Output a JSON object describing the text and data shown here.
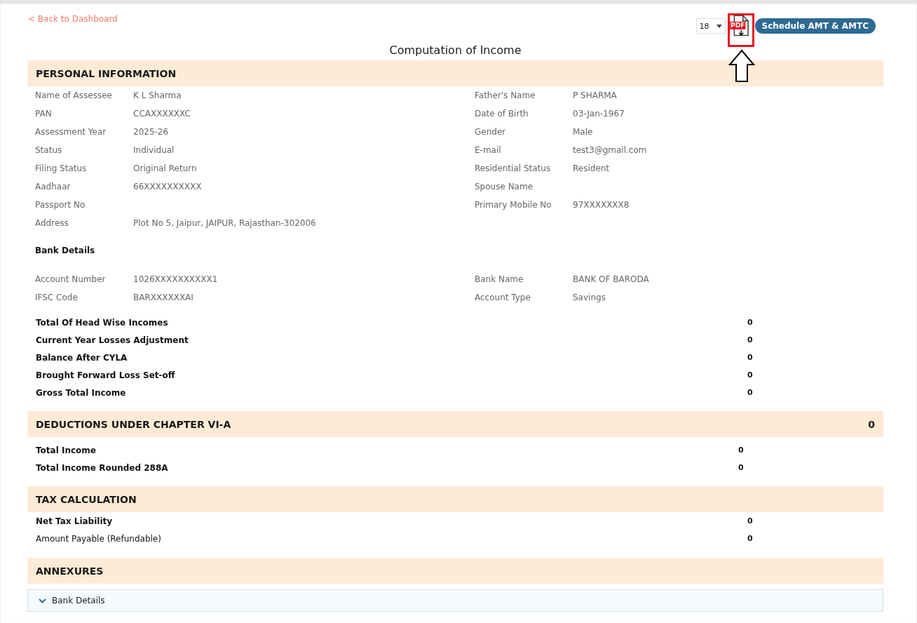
{
  "back_link": "< Back to Dashboard",
  "toolbar": {
    "select": {
      "value": "18"
    },
    "pdf_icon_label": "PDF",
    "button": "Schedule AMT & AMTC"
  },
  "title": "Computation of Income",
  "personal": {
    "heading": "PERSONAL INFORMATION",
    "left": [
      {
        "label": "Name of Assessee",
        "value": "K L Sharma"
      },
      {
        "label": "PAN",
        "value": "CCAXXXXXXC"
      },
      {
        "label": "Assessment Year",
        "value": "2025-26"
      },
      {
        "label": "Status",
        "value": "Individual"
      },
      {
        "label": "Filing Status",
        "value": "Original Return"
      },
      {
        "label": "Aadhaar",
        "value": "66XXXXXXXXXX"
      },
      {
        "label": "Passport No"
      },
      {
        "label": "Address",
        "value": "Plot No 5, Jaipur, JAIPUR, Rajasthan-302006"
      }
    ],
    "right": [
      {
        "label": "Father's Name",
        "value": "P SHARMA"
      },
      {
        "label": "Date of Birth",
        "value": "03-Jan-1967"
      },
      {
        "label": "Gender",
        "value": "Male"
      },
      {
        "label": "E-mail",
        "value": "test3@gmail.com"
      },
      {
        "label": "Residential Status",
        "value": "Resident"
      },
      {
        "label": "Spouse Name"
      },
      {
        "label": "Primary Mobile No",
        "value": "97XXXXXXX8"
      }
    ],
    "bank_heading": "Bank Details",
    "bank_left": [
      {
        "label": "Account Number",
        "value": "1026XXXXXXXXXX1"
      },
      {
        "label": "IFSC Code",
        "value": "BARXXXXXXAI"
      }
    ],
    "bank_right": [
      {
        "label": "Bank Name",
        "value": "BANK OF BARODA"
      },
      {
        "label": "Account Type",
        "value": "Savings"
      }
    ],
    "summary": [
      {
        "label": "Total Of Head Wise Incomes",
        "value": "0",
        "bold": true
      },
      {
        "label": "Current Year Losses Adjustment",
        "value": "0",
        "bold": true
      },
      {
        "label": "Balance After CYLA",
        "value": "0",
        "bold": true
      },
      {
        "label": "Brought Forward Loss Set-off",
        "value": "0",
        "bold": true
      },
      {
        "label": "Gross Total Income",
        "value": "0",
        "bold": true
      }
    ]
  },
  "deductions": {
    "heading": "DEDUCTIONS UNDER CHAPTER VI-A",
    "value": "0",
    "rows": [
      {
        "label": "Total Income",
        "value": "0",
        "bold": true
      },
      {
        "label": "Total Income Rounded 288A",
        "value": "0",
        "bold": true
      }
    ]
  },
  "tax": {
    "heading": "TAX CALCULATION",
    "rows": [
      {
        "label": "Net Tax Liability",
        "value": "0",
        "bold": true
      },
      {
        "label": "Amount Payable (Refundable)",
        "value": "0",
        "bold": false
      }
    ]
  },
  "annexures": {
    "heading": "ANNEXURES",
    "items": [
      {
        "label": "Bank Details",
        "expanded": false
      }
    ]
  }
}
